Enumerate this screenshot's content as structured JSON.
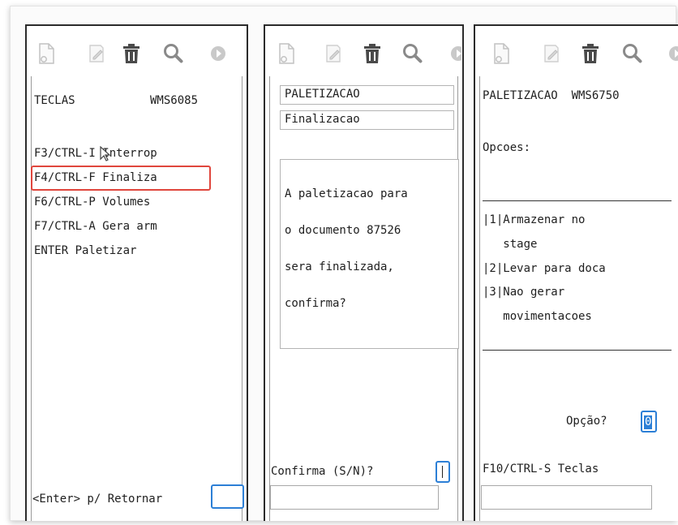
{
  "toolbar_icons": [
    "new-document-icon",
    "edit-icon",
    "trash-icon",
    "search-icon",
    "forward-icon"
  ],
  "colors": {
    "highlight": "#e0463d",
    "input_focus": "#2c7fd6",
    "panel_border": "#2b2b2b"
  },
  "panel1": {
    "header_title": "TECLAS",
    "header_code": "WMS6085",
    "keys": [
      "F3/CTRL-I Interrop",
      "F4/CTRL-F Finaliza",
      "F6/CTRL-P Volumes",
      "F7/CTRL-A Gera arm",
      "ENTER Paletizar"
    ],
    "highlighted_key_index": 1,
    "footer_prompt": "<Enter> p/ Retornar",
    "footer_input_value": ""
  },
  "panel2": {
    "title_field": "PALETIZACAO",
    "subtitle_field": "Finalizacao",
    "message_lines": [
      "A paletizacao para",
      "o documento 87526",
      "sera finalizada,",
      "confirma?"
    ],
    "confirm_prompt": "Confirma (S/N)?",
    "confirm_value": "",
    "command_value": ""
  },
  "panel3": {
    "header": "PALETIZACAO  WMS6750",
    "options_label": "Opcoes:",
    "options": [
      "|1|Armazenar no",
      "   stage",
      "|2|Levar para doca",
      "|3|Nao gerar",
      "   movimentacoes"
    ],
    "option_prompt": "Opção?",
    "option_value": "0",
    "footer": "F10/CTRL-S Teclas",
    "command_value": ""
  }
}
